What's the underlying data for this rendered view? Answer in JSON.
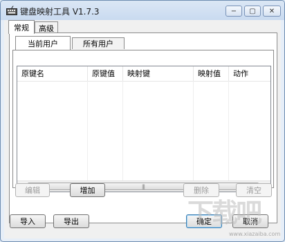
{
  "window": {
    "title": "键盘映射工具 V1.7.3",
    "buttons": {
      "minimize": "−",
      "maximize": "▢",
      "close": "✕"
    }
  },
  "top_tabs": [
    {
      "label": "常规",
      "active": true
    },
    {
      "label": "高级",
      "active": false
    }
  ],
  "sub_tabs": [
    {
      "label": "当前用户",
      "active": true
    },
    {
      "label": "所有用户",
      "active": false
    }
  ],
  "list": {
    "columns": [
      "原键名",
      "原键值",
      "映射键",
      "映射值",
      "动作"
    ],
    "rows": [],
    "scroll_left": "◀",
    "scroll_right": "▶",
    "thumb_grip": "|||"
  },
  "list_buttons": {
    "edit": {
      "label": "编辑",
      "enabled": false
    },
    "add": {
      "label": "增加",
      "enabled": true
    },
    "delete": {
      "label": "删除",
      "enabled": false
    },
    "clear": {
      "label": "清空",
      "enabled": false
    }
  },
  "bottom_buttons": {
    "import": "导入",
    "export": "导出",
    "ok": "确定",
    "cancel": "取消"
  },
  "watermark": {
    "main": "下载吧",
    "sub": "www.xiazaiba.com"
  },
  "colors": {
    "title_bar": "#c9daf0",
    "frame": "#e6eef8",
    "client": "#f0f0f0"
  }
}
